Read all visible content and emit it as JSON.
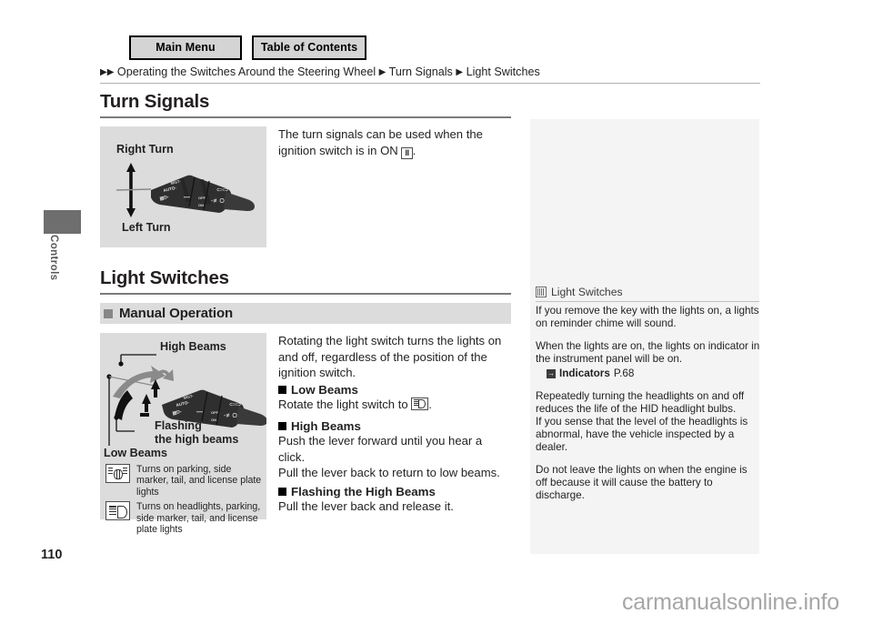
{
  "nav": {
    "main_menu": "Main Menu",
    "table_of_contents": "Table of Contents"
  },
  "breadcrumb": {
    "arrow": "▶",
    "items": [
      "Operating the Switches Around the Steering Wheel",
      "Turn Signals",
      "Light Switches"
    ]
  },
  "side": {
    "chapter": "Controls"
  },
  "page": {
    "number": "110",
    "watermark": "carmanualsonline.info"
  },
  "turn_signals": {
    "title": "Turn Signals",
    "figure": {
      "label_top": "Right Turn",
      "label_bottom": "Left Turn",
      "stalk_marks": [
        "MIST",
        "AUTO",
        "OFF",
        "ON"
      ]
    },
    "body_before": "The turn signals can be used when the ignition switch is in ON ",
    "key_glyph": "II",
    "body_after": "."
  },
  "light_switches": {
    "title": "Light Switches",
    "subsection": "Manual Operation",
    "figure": {
      "label_high_beams": "High Beams",
      "label_flashing_line1": "Flashing",
      "label_flashing_line2": "the high beams",
      "label_low_beams": "Low Beams"
    },
    "legend": [
      {
        "icon": "parking-lights-icon",
        "text": "Turns on parking, side marker, tail, and license plate lights"
      },
      {
        "icon": "headlights-icon",
        "text": "Turns on headlights, parking, side marker, tail, and license plate lights"
      }
    ],
    "intro": "Rotating the light switch turns the lights on and off, regardless of the position of the ignition switch.",
    "low_beams": {
      "heading": "Low Beams",
      "text_before": "Rotate the light switch to ",
      "icon": "low-beam-icon",
      "text_after": "."
    },
    "high_beams": {
      "heading": "High Beams",
      "line1": "Push the lever forward until you hear a click.",
      "line2": "Pull the lever back to return to low beams."
    },
    "flashing": {
      "heading": "Flashing the High Beams",
      "line1": "Pull the lever back and release it."
    }
  },
  "notes": {
    "header": "Light Switches",
    "paragraphs": [
      "If you remove the key with the lights on, a lights on reminder chime will sound.",
      "When the lights are on, the lights on indicator in the instrument panel will be on."
    ],
    "reference": {
      "badge": "→",
      "title": "Indicators",
      "page": "P.68"
    },
    "paragraphs_after": [
      "Repeatedly turning the headlights on and off reduces the life of the HID headlight bulbs.\nIf you sense that the level of the headlights is abnormal, have the vehicle inspected by a dealer.",
      "Do not leave the lights on when the engine is off because it will cause the battery to discharge."
    ]
  },
  "colors": {
    "figure_bg": "#dcdcdc",
    "subbar_bg": "#dcdcdc",
    "notes_bg": "#f4f4f4",
    "tab": "#6e6e6e",
    "rule": "#7b7b7b"
  }
}
